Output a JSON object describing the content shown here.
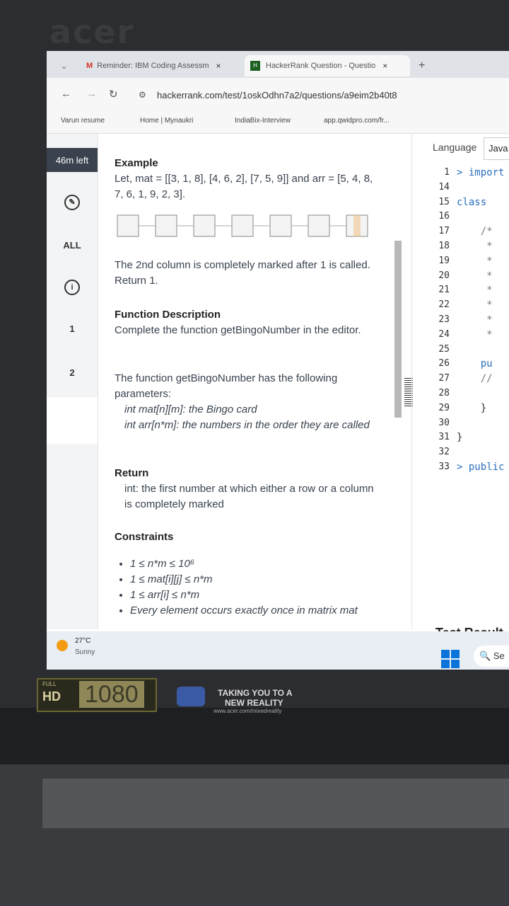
{
  "laptop": {
    "brand": "acer"
  },
  "tabs": [
    {
      "title": "Reminder: IBM Coding Assessm",
      "close": "×"
    },
    {
      "title": "HackerRank Question - Questio",
      "close": "×"
    }
  ],
  "new_tab": "+",
  "address": {
    "url": "hackerrank.com/test/1oskOdhn7a2/questions/a9eim2b40t8"
  },
  "bookmarks": [
    "Varun resume",
    "Home | Mynaukri",
    "IndiaBix-Interview",
    "app.qwidpro.com/fr..."
  ],
  "rail": {
    "timer": "46m left",
    "all": "ALL",
    "q1": "1",
    "q2": "2"
  },
  "question": {
    "example_h": "Example",
    "example_p": "Let, mat = [[3, 1, 8], [4, 6, 2], [7, 5, 9]] and arr = [5, 4, 8, 7, 6, 1, 9, 2, 3].",
    "marked_p": "The 2nd column is completely marked after 1 is called. Return 1.",
    "func_h": "Function Description",
    "func_p": "Complete the function getBingoNumber in the editor.",
    "params_p": "The function getBingoNumber has the following parameters:",
    "param1": "int mat[n][m]: the Bingo card",
    "param2": "int arr[n*m]: the numbers in the order they are called",
    "return_h": "Return",
    "return_p": "int: the first number at which either a row or a column is completely marked",
    "constraints_h": "Constraints",
    "c1": "1 ≤ n*m ≤ 10⁶",
    "c2": "1 ≤ mat[i][j] ≤ n*m",
    "c3": "1 ≤ arr[i] ≤ n*m",
    "c4": "Every element occurs exactly once in matrix mat"
  },
  "editor": {
    "language_label": "Language",
    "language_value": "Java",
    "line_numbers": [
      "1",
      "14",
      "15",
      "16",
      "17",
      "18",
      "19",
      "20",
      "21",
      "22",
      "23",
      "24",
      "25",
      "26",
      "27",
      "28",
      "29",
      "30",
      "31",
      "32",
      "33"
    ],
    "lines": [
      "> import",
      "",
      "class",
      "",
      "    /*",
      "     *",
      "     *",
      "     *",
      "     *",
      "     *",
      "     *",
      "     *",
      "",
      "    pu",
      "    //",
      "",
      "    }",
      "",
      "}",
      "",
      "> public"
    ],
    "test_results": "Test Result"
  },
  "taskbar": {
    "temp": "27°C",
    "condition": "Sunny",
    "search": "Se"
  },
  "stickers": {
    "hd_full": "FULL",
    "hd_hd": "HD",
    "hd_num": "1080",
    "vr_line1": "TAKING YOU TO A",
    "vr_line2": "NEW REALITY",
    "vr_url": "www.acer.com/mixedreality"
  }
}
